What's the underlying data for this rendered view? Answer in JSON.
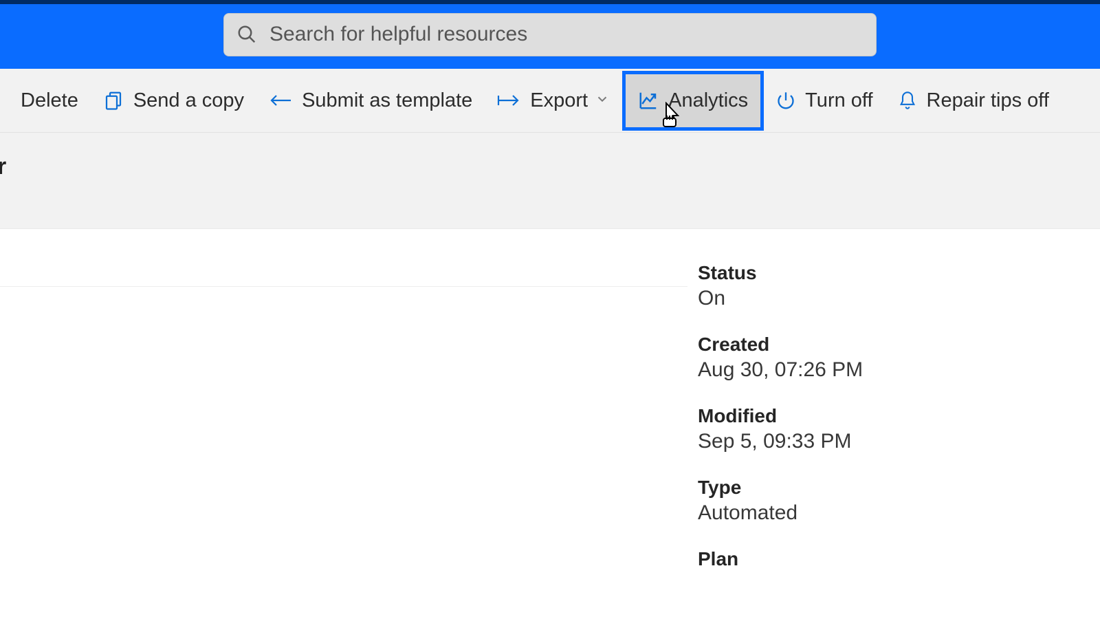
{
  "search": {
    "placeholder": "Search for helpful resources"
  },
  "commands": {
    "delete": "Delete",
    "send_copy": "Send a copy",
    "submit_template": "Submit as template",
    "export": "Export",
    "analytics": "Analytics",
    "turn_off": "Turn off",
    "repair_tips_off": "Repair tips off"
  },
  "subheader": {
    "title_fragment": "r"
  },
  "details": {
    "status_label": "Status",
    "status_value": "On",
    "created_label": "Created",
    "created_value": "Aug 30, 07:26 PM",
    "modified_label": "Modified",
    "modified_value": "Sep 5, 09:33 PM",
    "type_label": "Type",
    "type_value": "Automated",
    "plan_label": "Plan"
  }
}
